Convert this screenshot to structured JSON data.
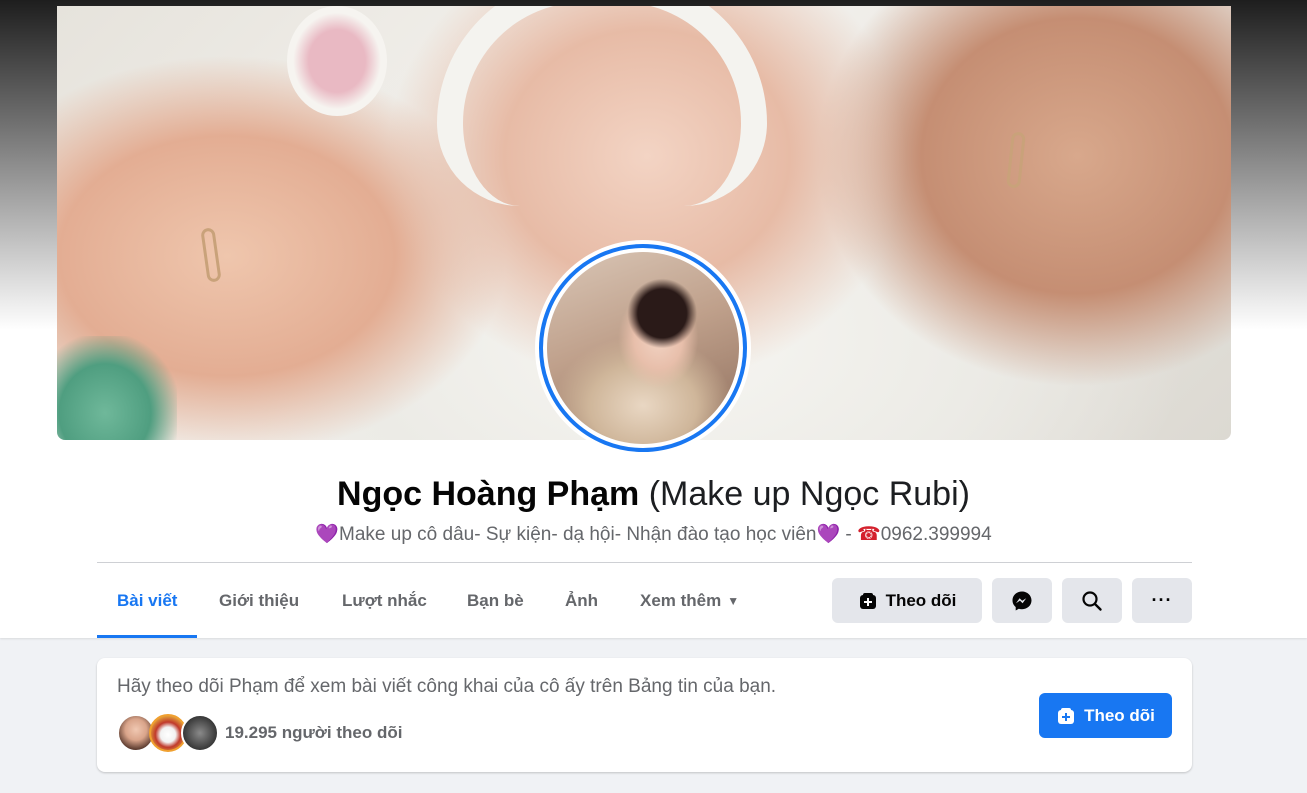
{
  "profile": {
    "name": "Ngọc Hoàng Phạm",
    "alt_name": "(Make up Ngọc Rubi)",
    "bio": "Make up cô dâu- Sự kiện- dạ hội- Nhận đào tạo học viên",
    "bio_separator": " - ",
    "phone": "0962.399994",
    "heart_glyph": "💜",
    "phone_glyph": "☎"
  },
  "tabs": [
    {
      "label": "Bài viết",
      "active": true
    },
    {
      "label": "Giới thiệu"
    },
    {
      "label": "Lượt nhắc"
    },
    {
      "label": "Bạn bè"
    },
    {
      "label": "Ảnh"
    },
    {
      "label": "Xem thêm"
    }
  ],
  "actions": {
    "follow_label": "Theo dõi",
    "more_label": "···",
    "icons": [
      "follow-plus-icon",
      "messenger-icon",
      "search-icon",
      "more-icon"
    ]
  },
  "follow_card": {
    "prompt": "Hãy theo dõi Phạm để xem bài viết công khai của cô ấy trên Bảng tin của bạn.",
    "followers_count": "19.295 người theo dõi",
    "button_label": "Theo dõi"
  },
  "colors": {
    "accent": "#1877f2",
    "secondary_text": "#65676b",
    "button_bg": "#e4e6eb",
    "page_bg": "#f0f2f5"
  }
}
